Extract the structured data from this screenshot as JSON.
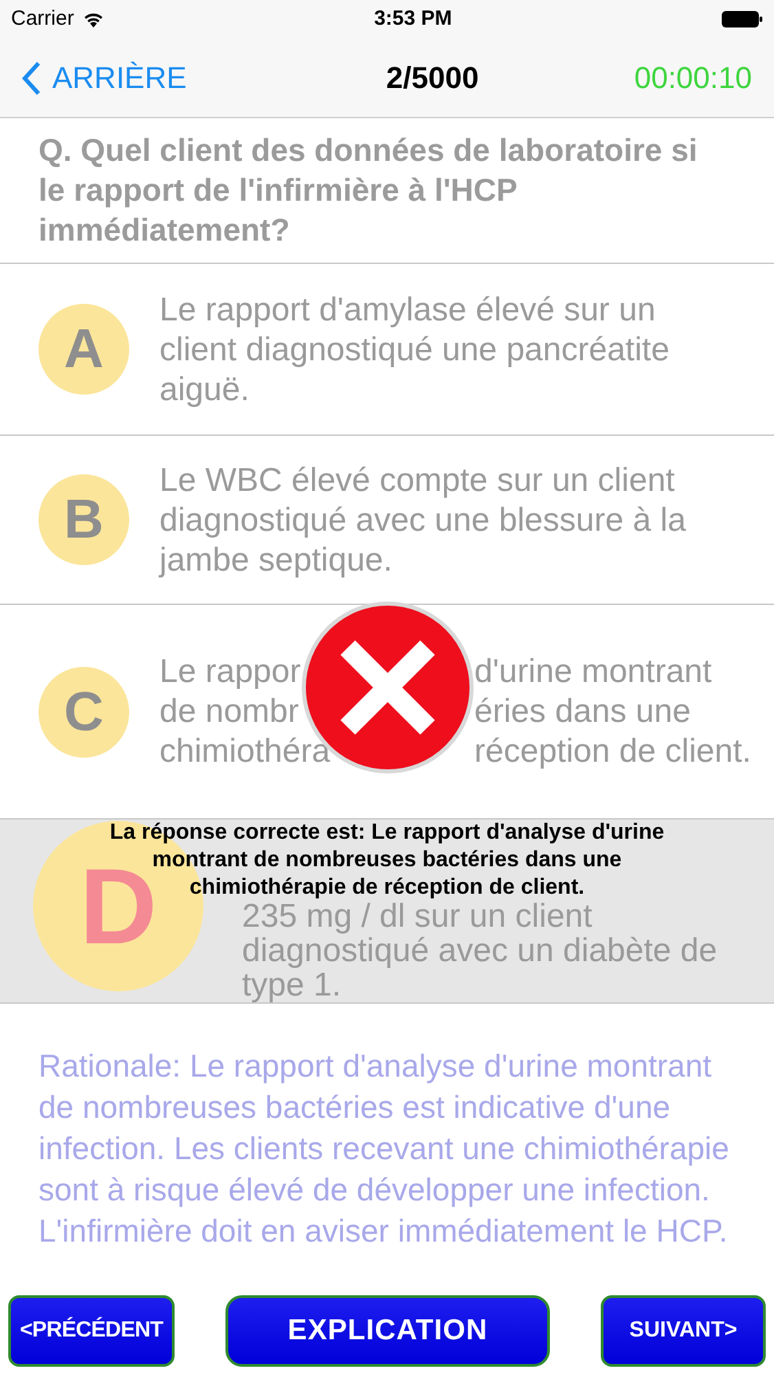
{
  "status_bar": {
    "carrier": "Carrier",
    "time": "3:53 PM"
  },
  "nav": {
    "back": "ARRIÈRE",
    "title": "2/5000",
    "timer": "00:00:10"
  },
  "question": "Q. Quel client des données de laboratoire si le rapport de l'infirmière à l'HCP immédiatement?",
  "options": [
    {
      "letter": "A",
      "text": "Le rapport d'amylase élevé sur un client diagnostiqué une pancréatite aiguë.",
      "selected": false
    },
    {
      "letter": "B",
      "text": "Le WBC élevé compte sur un client diagnostiqué avec une blessure à la jambe septique.",
      "selected": false
    },
    {
      "letter": "C",
      "lines": [
        [
          "Le rappor",
          "d'urine montrant"
        ],
        [
          "de nombr",
          "éries dans une"
        ],
        [
          "chimiothéra",
          "réception de client."
        ]
      ],
      "selected": false
    },
    {
      "letter": "D",
      "text": "235 mg / dl sur un client diagnostiqué avec un diabète de type 1.",
      "selected": true
    }
  ],
  "result": {
    "correct": false,
    "message": "La réponse correcte est:  Le rapport d'analyse d'urine montrant de nombreuses bactéries dans une chimiothérapie de réception de client."
  },
  "rationale": "Rationale: Le rapport d'analyse d'urine montrant de nombreuses bactéries est indicative d'une infection. Les clients recevant une chimiothérapie sont à risque élevé de développer une infection. L'infirmière doit en aviser immédiatement le HCP.",
  "buttons": {
    "previous": "<PRÉCÉDENT",
    "explanation": "EXPLICATION",
    "next": "SUIVANT>"
  }
}
